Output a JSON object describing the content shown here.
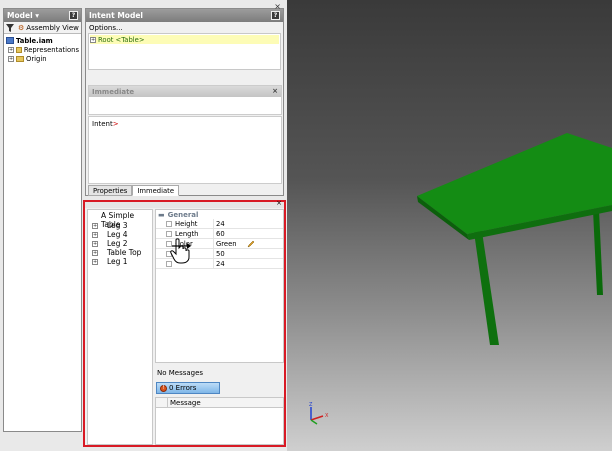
{
  "model_panel": {
    "title": "Model",
    "help": "?",
    "toolbar_label": "Assembly View",
    "tree": [
      {
        "label": "Table.iam"
      },
      {
        "label": "Representations"
      },
      {
        "label": "Origin"
      }
    ]
  },
  "intent_panel": {
    "title": "Intent Model",
    "help": "?",
    "options_label": "Options...",
    "root_label": "Root <Table>",
    "immediate_title": "Immediate",
    "intent_prompt_label": "Intent",
    "intent_prompt_symbol": ">",
    "tabs": [
      {
        "label": "Properties"
      },
      {
        "label": "Immediate"
      }
    ]
  },
  "property_panel": {
    "part_tree_title": "A Simple Table",
    "parts": [
      {
        "label": "Leg 3"
      },
      {
        "label": "Leg 4"
      },
      {
        "label": "Leg 2"
      },
      {
        "label": "Table Top"
      },
      {
        "label": "Leg 1"
      }
    ],
    "group_label": "General",
    "properties": [
      {
        "name": "Height",
        "value": "24"
      },
      {
        "name": "Length",
        "value": "60"
      },
      {
        "name": "Color",
        "value": "Green"
      },
      {
        "name": "",
        "value": "50"
      },
      {
        "name": "",
        "value": "24"
      }
    ],
    "messages_label": "No Messages",
    "errors_button": "0 Errors",
    "message_column": "Message"
  },
  "colors": {
    "highlight": "#d81a25",
    "table_green": "#0d7a0d"
  }
}
